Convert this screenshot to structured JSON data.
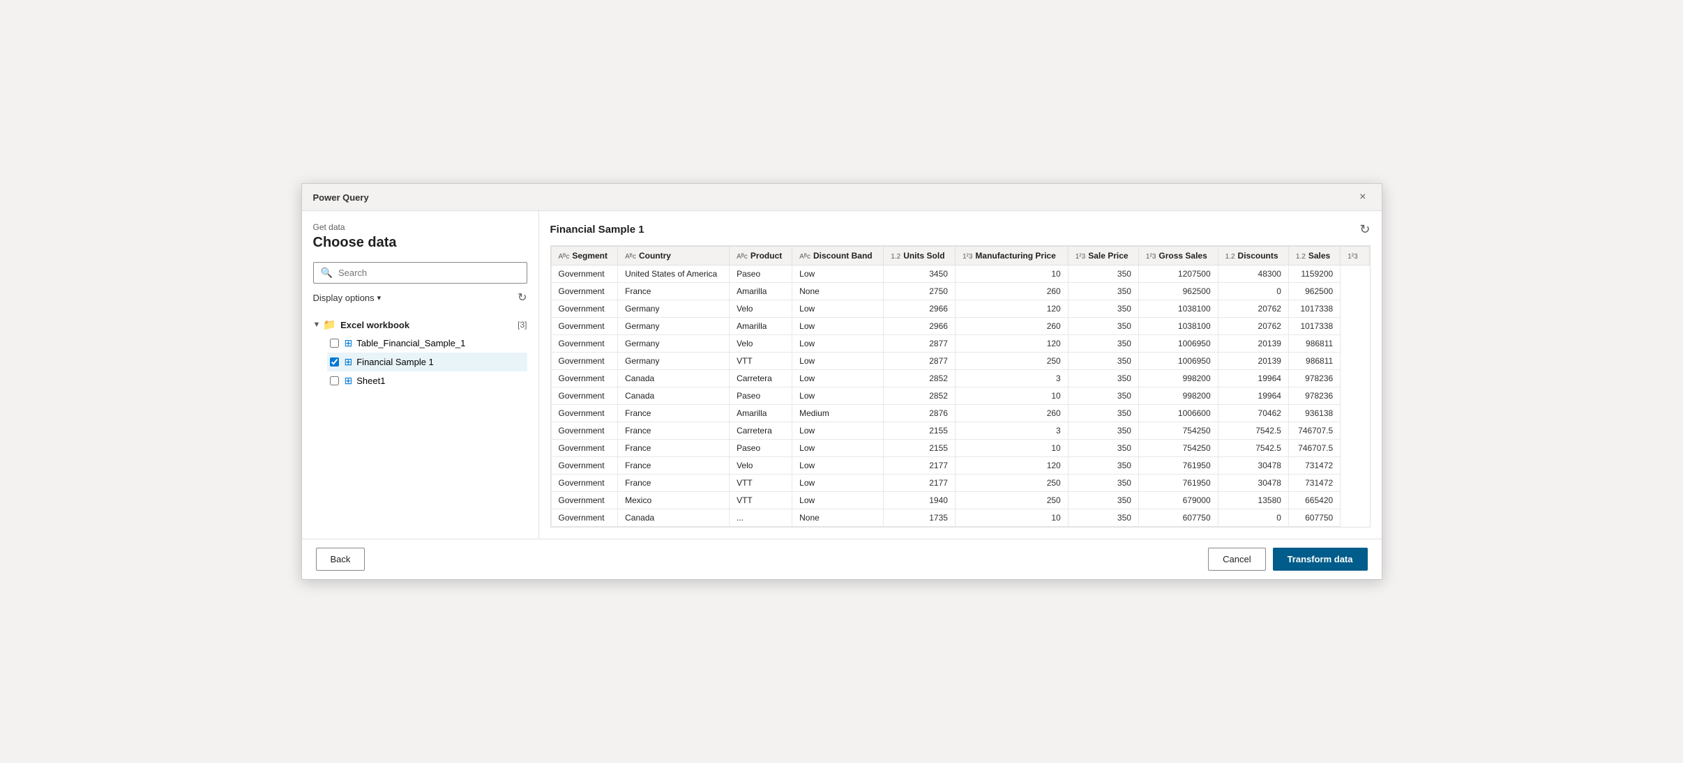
{
  "window": {
    "title": "Power Query",
    "close_label": "×"
  },
  "sidebar": {
    "get_data_label": "Get data",
    "choose_data_title": "Choose data",
    "search_placeholder": "Search",
    "display_options_label": "Display options",
    "tree": {
      "root_label": "Excel workbook",
      "root_count": "[3]",
      "children": [
        {
          "label": "Table_Financial_Sample_1",
          "checked": false,
          "selected": false
        },
        {
          "label": "Financial Sample 1",
          "checked": true,
          "selected": true
        },
        {
          "label": "Sheet1",
          "checked": false,
          "selected": false
        }
      ]
    }
  },
  "main": {
    "panel_title": "Financial Sample 1",
    "columns": [
      {
        "type": "ABC",
        "label": "Segment"
      },
      {
        "type": "ABC",
        "label": "Country"
      },
      {
        "type": "ABC",
        "label": "Product"
      },
      {
        "type": "ABC",
        "label": "Discount Band"
      },
      {
        "type": "1.2",
        "label": "Units Sold"
      },
      {
        "type": "1²3",
        "label": "Manufacturing Price"
      },
      {
        "type": "1²3",
        "label": "Sale Price"
      },
      {
        "type": "1²3",
        "label": "Gross Sales"
      },
      {
        "type": "1.2",
        "label": "Discounts"
      },
      {
        "type": "1.2",
        "label": "Sales"
      },
      {
        "type": "1²3",
        "label": "..."
      }
    ],
    "rows": [
      [
        "Government",
        "United States of America",
        "Paseo",
        "Low",
        "3450",
        "10",
        "350",
        "1207500",
        "48300",
        "1159200"
      ],
      [
        "Government",
        "France",
        "Amarilla",
        "None",
        "2750",
        "260",
        "350",
        "962500",
        "0",
        "962500"
      ],
      [
        "Government",
        "Germany",
        "Velo",
        "Low",
        "2966",
        "120",
        "350",
        "1038100",
        "20762",
        "1017338"
      ],
      [
        "Government",
        "Germany",
        "Amarilla",
        "Low",
        "2966",
        "260",
        "350",
        "1038100",
        "20762",
        "1017338"
      ],
      [
        "Government",
        "Germany",
        "Velo",
        "Low",
        "2877",
        "120",
        "350",
        "1006950",
        "20139",
        "986811"
      ],
      [
        "Government",
        "Germany",
        "VTT",
        "Low",
        "2877",
        "250",
        "350",
        "1006950",
        "20139",
        "986811"
      ],
      [
        "Government",
        "Canada",
        "Carretera",
        "Low",
        "2852",
        "3",
        "350",
        "998200",
        "19964",
        "978236"
      ],
      [
        "Government",
        "Canada",
        "Paseo",
        "Low",
        "2852",
        "10",
        "350",
        "998200",
        "19964",
        "978236"
      ],
      [
        "Government",
        "France",
        "Amarilla",
        "Medium",
        "2876",
        "260",
        "350",
        "1006600",
        "70462",
        "936138"
      ],
      [
        "Government",
        "France",
        "Carretera",
        "Low",
        "2155",
        "3",
        "350",
        "754250",
        "7542.5",
        "746707.5"
      ],
      [
        "Government",
        "France",
        "Paseo",
        "Low",
        "2155",
        "10",
        "350",
        "754250",
        "7542.5",
        "746707.5"
      ],
      [
        "Government",
        "France",
        "Velo",
        "Low",
        "2177",
        "120",
        "350",
        "761950",
        "30478",
        "731472"
      ],
      [
        "Government",
        "France",
        "VTT",
        "Low",
        "2177",
        "250",
        "350",
        "761950",
        "30478",
        "731472"
      ],
      [
        "Government",
        "Mexico",
        "VTT",
        "Low",
        "1940",
        "250",
        "350",
        "679000",
        "13580",
        "665420"
      ],
      [
        "Government",
        "Canada",
        "...",
        "None",
        "1735",
        "10",
        "350",
        "607750",
        "0",
        "607750"
      ]
    ]
  },
  "footer": {
    "back_label": "Back",
    "cancel_label": "Cancel",
    "transform_label": "Transform data"
  }
}
